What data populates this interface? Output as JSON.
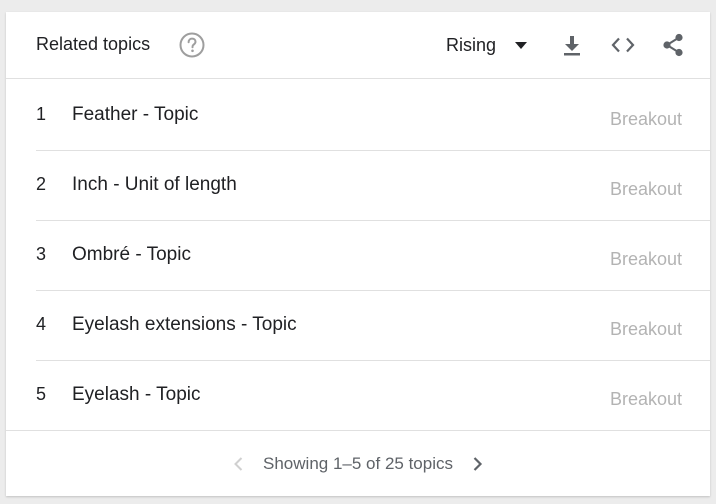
{
  "widget": {
    "title": "Related topics",
    "help_icon": "help-circle-icon",
    "sort_value": "Rising",
    "toolbar_icons": [
      "download-icon",
      "embed-code-icon",
      "share-icon"
    ]
  },
  "rows": [
    {
      "rank": "1",
      "topic": "Feather - Topic",
      "value": "Breakout"
    },
    {
      "rank": "2",
      "topic": "Inch - Unit of length",
      "value": "Breakout"
    },
    {
      "rank": "3",
      "topic": "Ombré - Topic",
      "value": "Breakout"
    },
    {
      "rank": "4",
      "topic": "Eyelash extensions - Topic",
      "value": "Breakout"
    },
    {
      "rank": "5",
      "topic": "Eyelash - Topic",
      "value": "Breakout"
    }
  ],
  "pagination": {
    "text": "Showing 1–5 of 25 topics"
  },
  "colors": {
    "text": "#202124",
    "muted": "#b3b3b3",
    "icon": "#5f6368",
    "divider": "#e0e0e0"
  }
}
